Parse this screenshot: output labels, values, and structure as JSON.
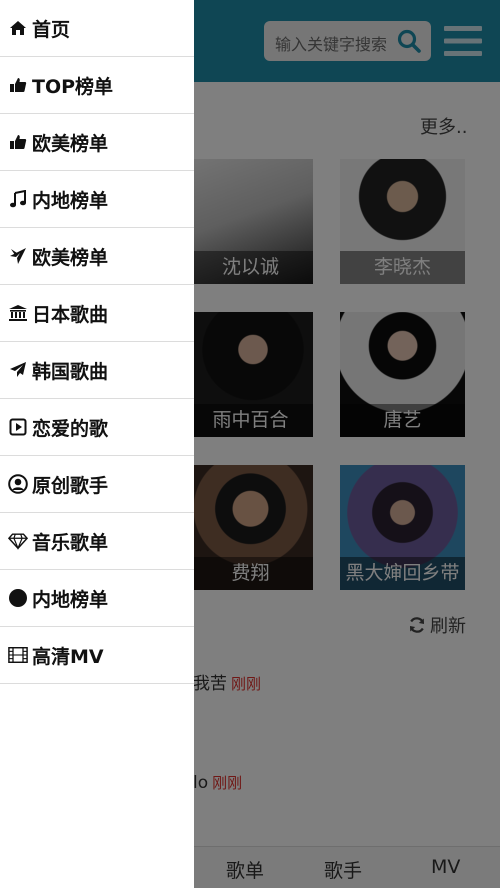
{
  "header": {
    "search_placeholder": "输入关键字搜索",
    "brand_color": "#1f8da8"
  },
  "section": {
    "more_label": "更多..",
    "refresh_label": "刷新"
  },
  "artists": [
    {
      "name": "沈以诚"
    },
    {
      "name": "李晓杰"
    },
    {
      "name": "雨中百合"
    },
    {
      "name": "唐艺"
    },
    {
      "name": "费翔"
    },
    {
      "name": "黑大婶回乡带"
    }
  ],
  "songs": [
    {
      "title": "我苦",
      "tag": "刚刚"
    },
    {
      "title": "lo",
      "tag": "刚刚"
    }
  ],
  "song_tag_color": "#e0312d",
  "tabbar": {
    "tabs": [
      "歌单",
      "歌手",
      "MV"
    ]
  },
  "drawer": {
    "items": [
      {
        "label": "首页",
        "icon": "home-icon"
      },
      {
        "label": "TOP榜单",
        "icon": "thumbs-up-icon"
      },
      {
        "label": "欧美榜单",
        "icon": "thumbs-up-icon"
      },
      {
        "label": "内地榜单",
        "icon": "music-note-icon"
      },
      {
        "label": "欧美榜单",
        "icon": "plane-icon"
      },
      {
        "label": "日本歌曲",
        "icon": "bank-icon"
      },
      {
        "label": "韩国歌曲",
        "icon": "paper-plane-icon"
      },
      {
        "label": "恋爱的歌",
        "icon": "play-square-icon"
      },
      {
        "label": "原创歌手",
        "icon": "user-circle-icon"
      },
      {
        "label": "音乐歌单",
        "icon": "diamond-icon"
      },
      {
        "label": "内地榜单",
        "icon": "circle-icon"
      },
      {
        "label": "高清MV",
        "icon": "film-icon"
      }
    ]
  }
}
